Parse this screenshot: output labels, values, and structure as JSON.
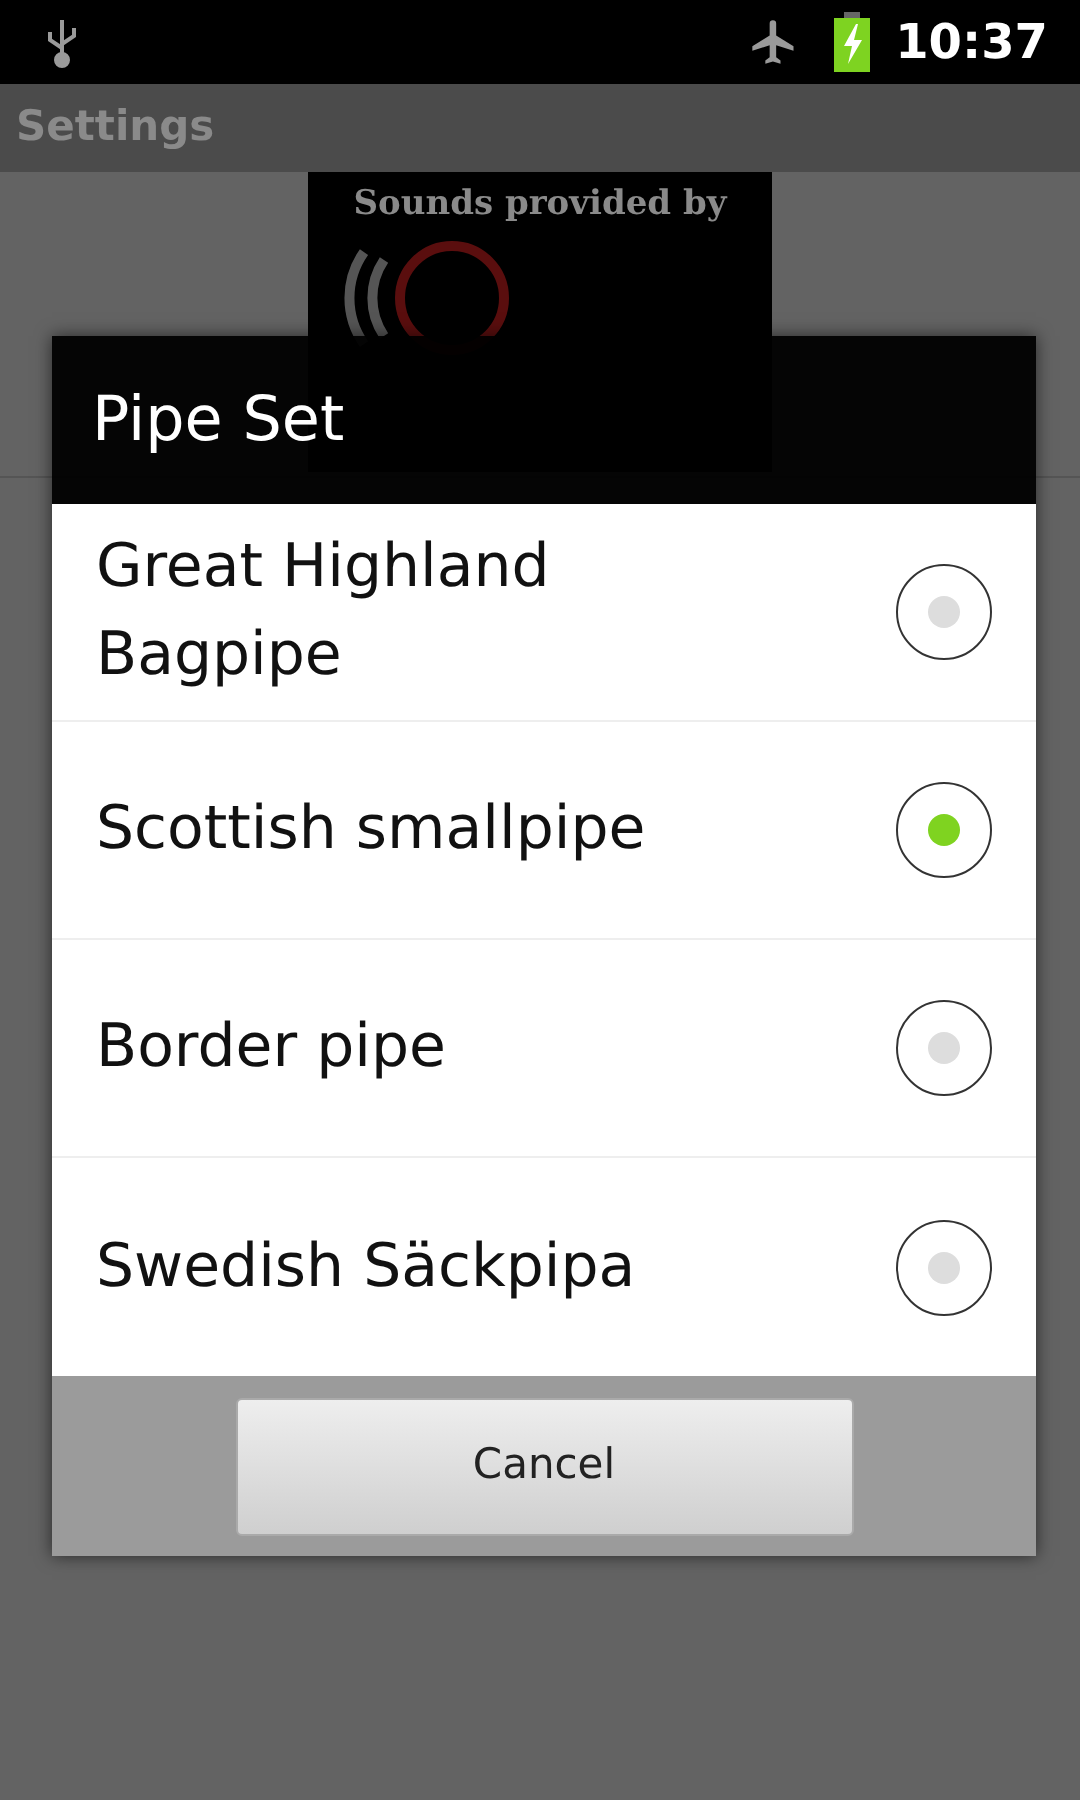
{
  "status_bar": {
    "time": "10:37",
    "battery_charging": true
  },
  "app_bar": {
    "title": "Settings"
  },
  "banner": {
    "caption": "Sounds provided by"
  },
  "dialog": {
    "title": "Pipe Set",
    "options": [
      {
        "label": "Great Highland Bagpipe",
        "selected": false
      },
      {
        "label": "Scottish smallpipe",
        "selected": true
      },
      {
        "label": "Border pipe",
        "selected": false
      },
      {
        "label": "Swedish Säckpipa",
        "selected": false
      }
    ],
    "buttons": [
      "Cancel"
    ]
  }
}
